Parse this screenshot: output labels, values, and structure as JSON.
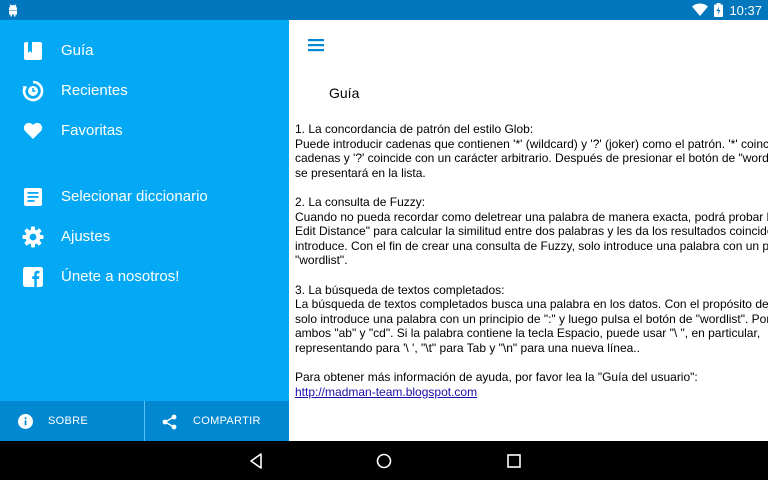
{
  "status": {
    "time": "10:37",
    "icons": [
      "android-debug-icon",
      "wifi-icon",
      "battery-icon"
    ]
  },
  "drawer": {
    "items": [
      {
        "label": "Guía",
        "icon": "book-icon"
      },
      {
        "label": "Recientes",
        "icon": "history-icon"
      },
      {
        "label": "Favoritas",
        "icon": "heart-icon"
      },
      {
        "label": "Selecionar diccionario",
        "icon": "dictionary-icon"
      },
      {
        "label": "Ajustes",
        "icon": "settings-icon"
      },
      {
        "label": "Únete a nosotros!",
        "icon": "facebook-icon"
      }
    ],
    "footer": {
      "about_label": "SOBRE",
      "share_label": "COMPARTIR"
    }
  },
  "main": {
    "title": "Guía",
    "sections": [
      {
        "heading": "1. La concordancia de patrón del estilo Glob:",
        "lines": [
          "Puede introducir cadenas que contienen '*' (wildcard) y '?' (joker) como el patrón. '*' coincide con cero o más",
          "cadenas y '?' coincide con un carácter arbitrario. Después de presionar el botón de \"wordlist\", el resultado",
          "se presentará en la lista."
        ]
      },
      {
        "heading": "2. La consulta de Fuzzy:",
        "lines": [
          "Cuando no pueda recordar como deletrear una palabra de manera exacta, podrá probar la consulta de Fuzzy. Utiliza",
          "Edit Distance\" para calcular la similitud entre dos palabras y les da los resultados coincidentes. Si desea",
          "introduce. Con el fin de crear una consulta de Fuzzy, solo introduce una palabra con un principio de \"/\" y pulsa",
          "\"wordlist\"."
        ]
      },
      {
        "heading": "3. La búsqueda de textos completados:",
        "lines": [
          "La búsqueda de textos completados busca una palabra en los datos. Con el propósito de crear esta búsqueda,",
          "solo introduce una palabra con un principio de \":\" y luego pulsa el botón de \"wordlist\". Por ejemplo, \":ab cd\" busca",
          "ambos \"ab\" y \"cd\". Si la palabra contiene la tecla Espacio, puede usar \"\\ \", en particular,",
          "representando para '\\ ', \"\\t\" para Tab y \"\\n\" para una nueva línea.."
        ]
      }
    ],
    "help_text": "Para obtener más información de ayuda, por favor lea la \"Guía del usuario\":",
    "help_link": "http://madman-team.blogspot.com"
  },
  "navbar": {
    "icons": [
      "back-icon",
      "home-icon",
      "recents-icon"
    ]
  },
  "colors": {
    "statusbar": "#0277bd",
    "drawer": "#03a9f4",
    "drawer_footer": "#0288d1",
    "menu_icon": "#0288d1",
    "link": "#1a0dab"
  }
}
